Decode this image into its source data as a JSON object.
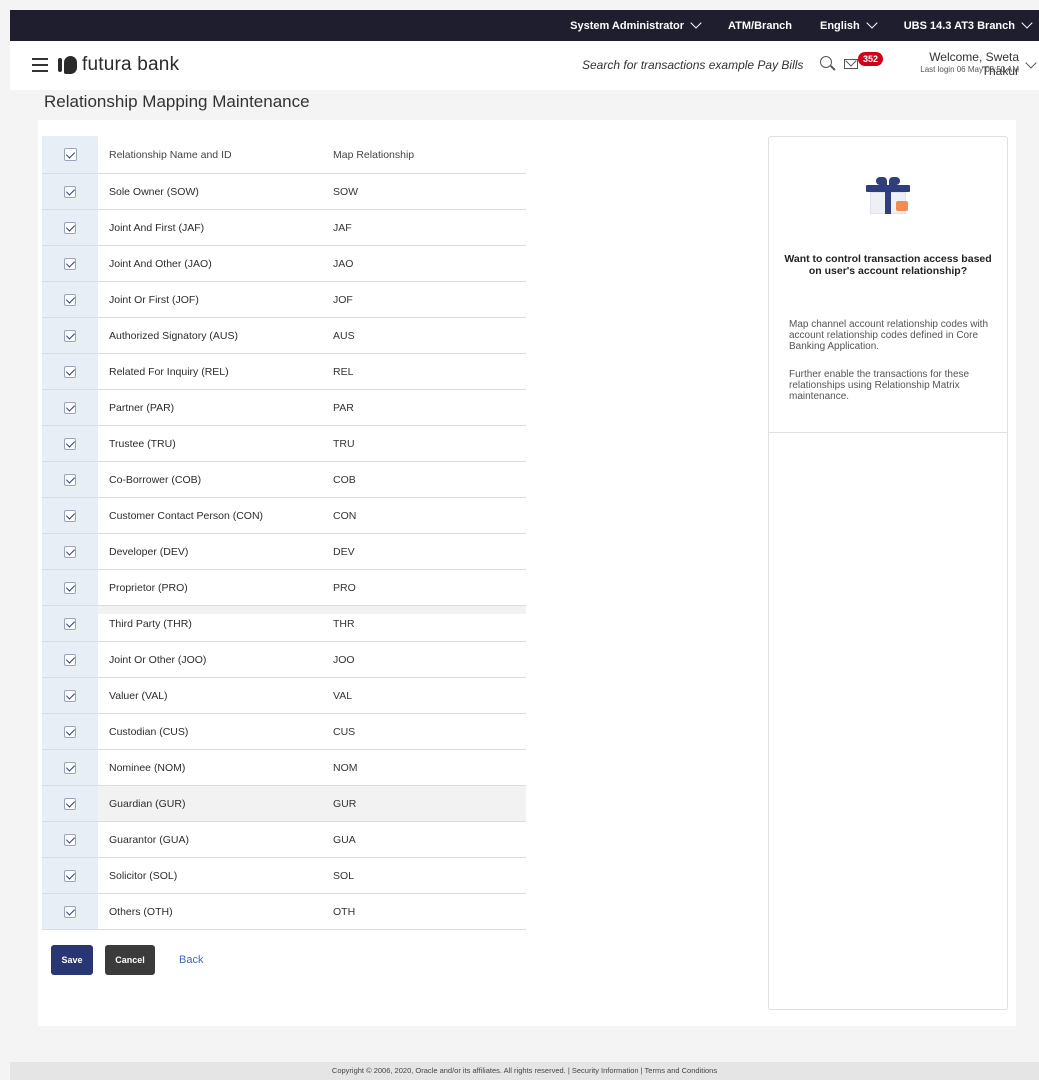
{
  "topbar": {
    "role": "System Administrator",
    "branch": "ATM/Branch",
    "language": "English",
    "entity": "UBS 14.3 AT3 Branch"
  },
  "header": {
    "brand": "futura bank",
    "search_placeholder": "Search for transactions example Pay Bills",
    "notification_count": "352",
    "welcome": "Welcome, Sweta Thakur",
    "last_login": "Last login 06 May 03:50 AM"
  },
  "page": {
    "title": "Relationship Mapping Maintenance"
  },
  "table": {
    "headers": {
      "name": "Relationship Name and ID",
      "map": "Map Relationship"
    },
    "rows": [
      {
        "name": "Sole Owner (SOW)",
        "code": "SOW"
      },
      {
        "name": "Joint And First (JAF)",
        "code": "JAF"
      },
      {
        "name": "Joint And Other (JAO)",
        "code": "JAO"
      },
      {
        "name": "Joint Or First (JOF)",
        "code": "JOF"
      },
      {
        "name": "Authorized Signatory (AUS)",
        "code": "AUS"
      },
      {
        "name": "Related For Inquiry (REL)",
        "code": "REL"
      },
      {
        "name": "Partner (PAR)",
        "code": "PAR"
      },
      {
        "name": "Trustee (TRU)",
        "code": "TRU"
      },
      {
        "name": "Co-Borrower (COB)",
        "code": "COB"
      },
      {
        "name": "Customer Contact Person (CON)",
        "code": "CON"
      },
      {
        "name": "Developer (DEV)",
        "code": "DEV"
      },
      {
        "name": "Proprietor (PRO)",
        "code": "PRO"
      },
      {
        "name": "Third Party (THR)",
        "code": "THR"
      },
      {
        "name": "Joint Or Other (JOO)",
        "code": "JOO"
      },
      {
        "name": "Valuer (VAL)",
        "code": "VAL"
      },
      {
        "name": "Custodian (CUS)",
        "code": "CUS"
      },
      {
        "name": "Nominee (NOM)",
        "code": "NOM"
      },
      {
        "name": "Guardian (GUR)",
        "code": "GUR"
      },
      {
        "name": "Guarantor (GUA)",
        "code": "GUA"
      },
      {
        "name": "Solicitor (SOL)",
        "code": "SOL"
      },
      {
        "name": "Others (OTH)",
        "code": "OTH"
      }
    ]
  },
  "actions": {
    "save": "Save",
    "cancel": "Cancel",
    "back": "Back"
  },
  "info": {
    "title": "Want to control transaction access based on user's account relationship?",
    "p1": "Map channel account relationship codes with account relationship codes defined in Core Banking Application.",
    "p2": "Further enable the transactions for these relationships using Relationship Matrix maintenance."
  },
  "footer": {
    "text": "Copyright © 2006, 2020, Oracle and/or its affiliates. All rights reserved. | Security Information | Terms and Conditions"
  }
}
